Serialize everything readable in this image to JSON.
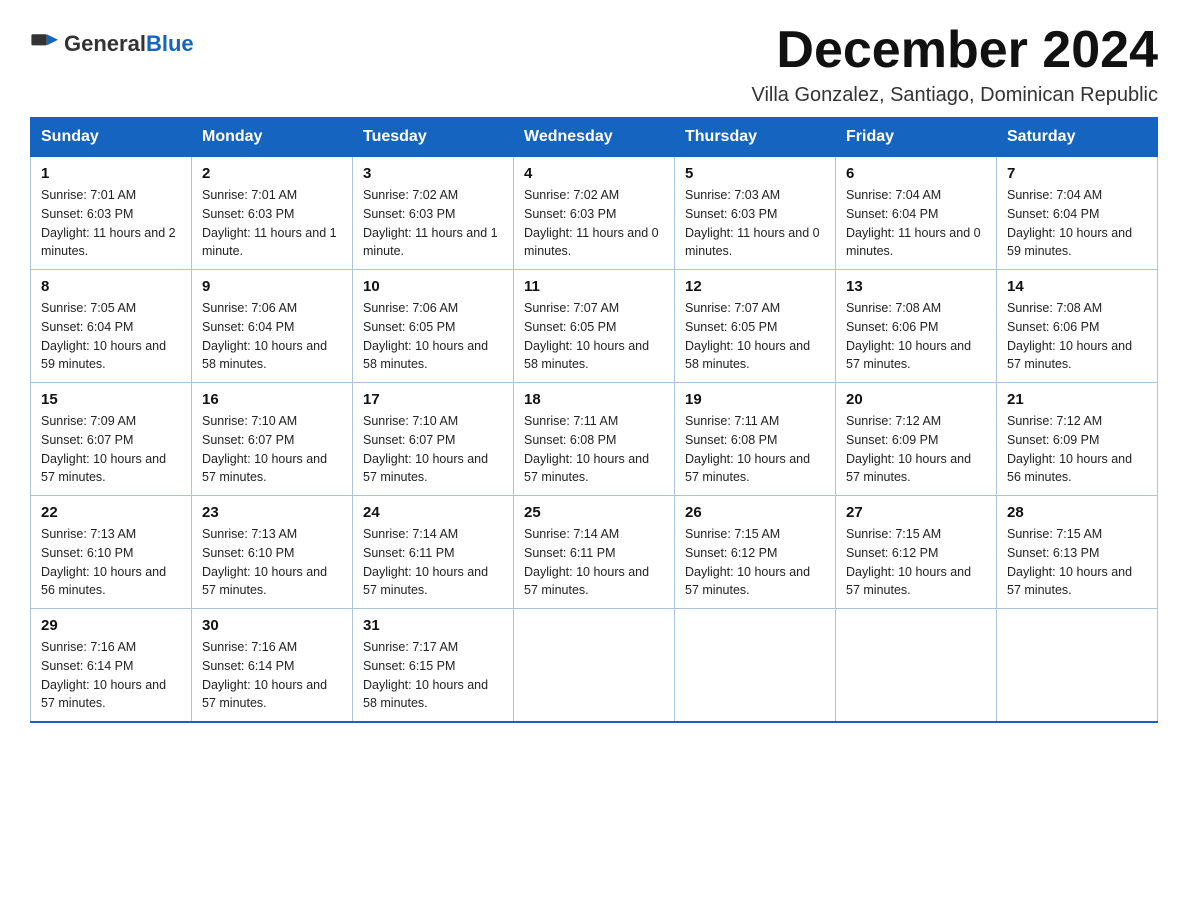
{
  "logo": {
    "general": "General",
    "blue": "Blue"
  },
  "header": {
    "title": "December 2024",
    "subtitle": "Villa Gonzalez, Santiago, Dominican Republic"
  },
  "weekdays": [
    "Sunday",
    "Monday",
    "Tuesday",
    "Wednesday",
    "Thursday",
    "Friday",
    "Saturday"
  ],
  "weeks": [
    [
      {
        "day": "1",
        "sunrise": "7:01 AM",
        "sunset": "6:03 PM",
        "daylight": "11 hours and 2 minutes."
      },
      {
        "day": "2",
        "sunrise": "7:01 AM",
        "sunset": "6:03 PM",
        "daylight": "11 hours and 1 minute."
      },
      {
        "day": "3",
        "sunrise": "7:02 AM",
        "sunset": "6:03 PM",
        "daylight": "11 hours and 1 minute."
      },
      {
        "day": "4",
        "sunrise": "7:02 AM",
        "sunset": "6:03 PM",
        "daylight": "11 hours and 0 minutes."
      },
      {
        "day": "5",
        "sunrise": "7:03 AM",
        "sunset": "6:03 PM",
        "daylight": "11 hours and 0 minutes."
      },
      {
        "day": "6",
        "sunrise": "7:04 AM",
        "sunset": "6:04 PM",
        "daylight": "11 hours and 0 minutes."
      },
      {
        "day": "7",
        "sunrise": "7:04 AM",
        "sunset": "6:04 PM",
        "daylight": "10 hours and 59 minutes."
      }
    ],
    [
      {
        "day": "8",
        "sunrise": "7:05 AM",
        "sunset": "6:04 PM",
        "daylight": "10 hours and 59 minutes."
      },
      {
        "day": "9",
        "sunrise": "7:06 AM",
        "sunset": "6:04 PM",
        "daylight": "10 hours and 58 minutes."
      },
      {
        "day": "10",
        "sunrise": "7:06 AM",
        "sunset": "6:05 PM",
        "daylight": "10 hours and 58 minutes."
      },
      {
        "day": "11",
        "sunrise": "7:07 AM",
        "sunset": "6:05 PM",
        "daylight": "10 hours and 58 minutes."
      },
      {
        "day": "12",
        "sunrise": "7:07 AM",
        "sunset": "6:05 PM",
        "daylight": "10 hours and 58 minutes."
      },
      {
        "day": "13",
        "sunrise": "7:08 AM",
        "sunset": "6:06 PM",
        "daylight": "10 hours and 57 minutes."
      },
      {
        "day": "14",
        "sunrise": "7:08 AM",
        "sunset": "6:06 PM",
        "daylight": "10 hours and 57 minutes."
      }
    ],
    [
      {
        "day": "15",
        "sunrise": "7:09 AM",
        "sunset": "6:07 PM",
        "daylight": "10 hours and 57 minutes."
      },
      {
        "day": "16",
        "sunrise": "7:10 AM",
        "sunset": "6:07 PM",
        "daylight": "10 hours and 57 minutes."
      },
      {
        "day": "17",
        "sunrise": "7:10 AM",
        "sunset": "6:07 PM",
        "daylight": "10 hours and 57 minutes."
      },
      {
        "day": "18",
        "sunrise": "7:11 AM",
        "sunset": "6:08 PM",
        "daylight": "10 hours and 57 minutes."
      },
      {
        "day": "19",
        "sunrise": "7:11 AM",
        "sunset": "6:08 PM",
        "daylight": "10 hours and 57 minutes."
      },
      {
        "day": "20",
        "sunrise": "7:12 AM",
        "sunset": "6:09 PM",
        "daylight": "10 hours and 57 minutes."
      },
      {
        "day": "21",
        "sunrise": "7:12 AM",
        "sunset": "6:09 PM",
        "daylight": "10 hours and 56 minutes."
      }
    ],
    [
      {
        "day": "22",
        "sunrise": "7:13 AM",
        "sunset": "6:10 PM",
        "daylight": "10 hours and 56 minutes."
      },
      {
        "day": "23",
        "sunrise": "7:13 AM",
        "sunset": "6:10 PM",
        "daylight": "10 hours and 57 minutes."
      },
      {
        "day": "24",
        "sunrise": "7:14 AM",
        "sunset": "6:11 PM",
        "daylight": "10 hours and 57 minutes."
      },
      {
        "day": "25",
        "sunrise": "7:14 AM",
        "sunset": "6:11 PM",
        "daylight": "10 hours and 57 minutes."
      },
      {
        "day": "26",
        "sunrise": "7:15 AM",
        "sunset": "6:12 PM",
        "daylight": "10 hours and 57 minutes."
      },
      {
        "day": "27",
        "sunrise": "7:15 AM",
        "sunset": "6:12 PM",
        "daylight": "10 hours and 57 minutes."
      },
      {
        "day": "28",
        "sunrise": "7:15 AM",
        "sunset": "6:13 PM",
        "daylight": "10 hours and 57 minutes."
      }
    ],
    [
      {
        "day": "29",
        "sunrise": "7:16 AM",
        "sunset": "6:14 PM",
        "daylight": "10 hours and 57 minutes."
      },
      {
        "day": "30",
        "sunrise": "7:16 AM",
        "sunset": "6:14 PM",
        "daylight": "10 hours and 57 minutes."
      },
      {
        "day": "31",
        "sunrise": "7:17 AM",
        "sunset": "6:15 PM",
        "daylight": "10 hours and 58 minutes."
      },
      null,
      null,
      null,
      null
    ]
  ]
}
